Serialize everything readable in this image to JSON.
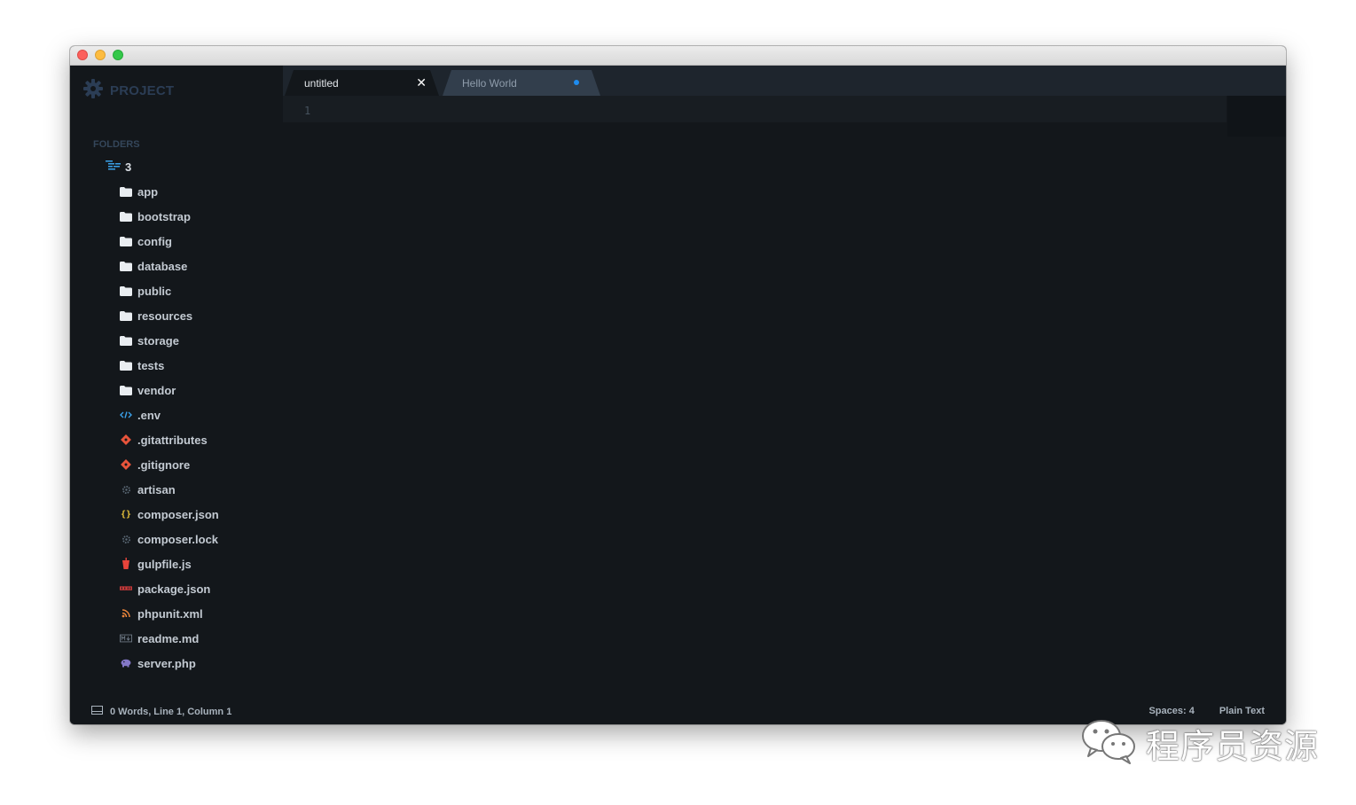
{
  "sidebar": {
    "title": "PROJECT",
    "folders_label": "FOLDERS",
    "root": "3",
    "items": [
      {
        "label": "app",
        "icon": "folder-icon"
      },
      {
        "label": "bootstrap",
        "icon": "folder-icon"
      },
      {
        "label": "config",
        "icon": "folder-icon"
      },
      {
        "label": "database",
        "icon": "folder-icon"
      },
      {
        "label": "public",
        "icon": "folder-icon"
      },
      {
        "label": "resources",
        "icon": "folder-icon"
      },
      {
        "label": "storage",
        "icon": "folder-icon"
      },
      {
        "label": "tests",
        "icon": "folder-icon"
      },
      {
        "label": "vendor",
        "icon": "folder-icon"
      },
      {
        "label": ".env",
        "icon": "code-icon"
      },
      {
        "label": ".gitattributes",
        "icon": "git-icon"
      },
      {
        "label": ".gitignore",
        "icon": "git-icon"
      },
      {
        "label": "artisan",
        "icon": "gear-icon"
      },
      {
        "label": "composer.json",
        "icon": "braces-icon"
      },
      {
        "label": "composer.lock",
        "icon": "gear-icon"
      },
      {
        "label": "gulpfile.js",
        "icon": "gulp-icon"
      },
      {
        "label": "package.json",
        "icon": "npm-icon"
      },
      {
        "label": "phpunit.xml",
        "icon": "rss-icon"
      },
      {
        "label": "readme.md",
        "icon": "markdown-icon"
      },
      {
        "label": "server.php",
        "icon": "elephant-icon"
      }
    ]
  },
  "tabs": [
    {
      "label": "untitled",
      "active": true
    },
    {
      "label": "Hello World",
      "active": false,
      "modified": true
    }
  ],
  "editor": {
    "line_numbers": [
      "1"
    ]
  },
  "statusbar": {
    "left": "0 Words, Line 1, Column 1",
    "spaces": "Spaces: 4",
    "syntax": "Plain Text"
  },
  "watermark": {
    "text": "程序员资源"
  },
  "colors": {
    "editor_bg": "#13171b",
    "tabbar_bg": "#1e252d",
    "inactive_tab": "#323e4c",
    "modified_dot": "#1e8cf0",
    "git_icon": "#e8543b"
  }
}
